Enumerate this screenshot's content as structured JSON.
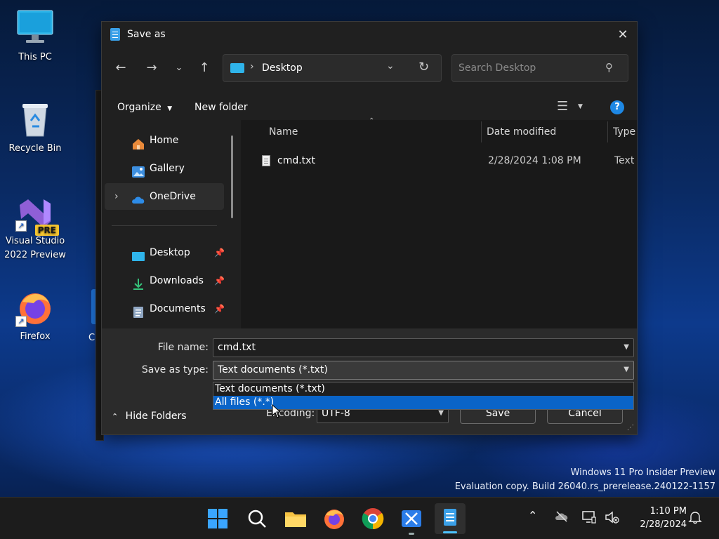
{
  "desktop": {
    "icons": [
      {
        "label": "This PC"
      },
      {
        "label": "Recycle Bin"
      },
      {
        "label": "Visual Studio\n2022 Preview",
        "badge": "PRE"
      },
      {
        "label": "Firefox"
      }
    ],
    "partial_label": "C",
    "watermark": {
      "line1": "Windows 11 Pro Insider Preview",
      "line2": "Evaluation copy. Build 26040.rs_prerelease.240122-1157"
    }
  },
  "dialog": {
    "title": "Save as",
    "address": {
      "crumb": "Desktop"
    },
    "search": {
      "placeholder": "Search Desktop"
    },
    "commands": {
      "organize": "Organize",
      "new_folder": "New folder"
    },
    "sidebar": {
      "items": [
        {
          "label": "Home"
        },
        {
          "label": "Gallery"
        },
        {
          "label": "OneDrive"
        },
        {
          "label": "Desktop"
        },
        {
          "label": "Downloads"
        },
        {
          "label": "Documents"
        }
      ]
    },
    "columns": {
      "name": "Name",
      "date": "Date modified",
      "type": "Type"
    },
    "files": [
      {
        "name": "cmd.txt",
        "date": "2/28/2024 1:08 PM",
        "type": "Text D"
      }
    ],
    "form": {
      "file_name_label": "File name:",
      "file_name_value": "cmd.txt",
      "type_label": "Save as type:",
      "type_value": "Text documents (*.txt)",
      "type_options": [
        "Text documents (*.txt)",
        "All files  (*.*)"
      ],
      "selected_option_index": 1,
      "encoding_label": "Encoding:",
      "encoding_value": "UTF-8",
      "save": "Save",
      "cancel": "Cancel",
      "hide_folders": "Hide Folders"
    }
  },
  "taskbar": {
    "time": "1:10 PM",
    "date": "2/28/2024"
  },
  "colors": {
    "accent": "#0078d4",
    "selection": "#0a64c8",
    "dialog_bg": "#202020"
  }
}
